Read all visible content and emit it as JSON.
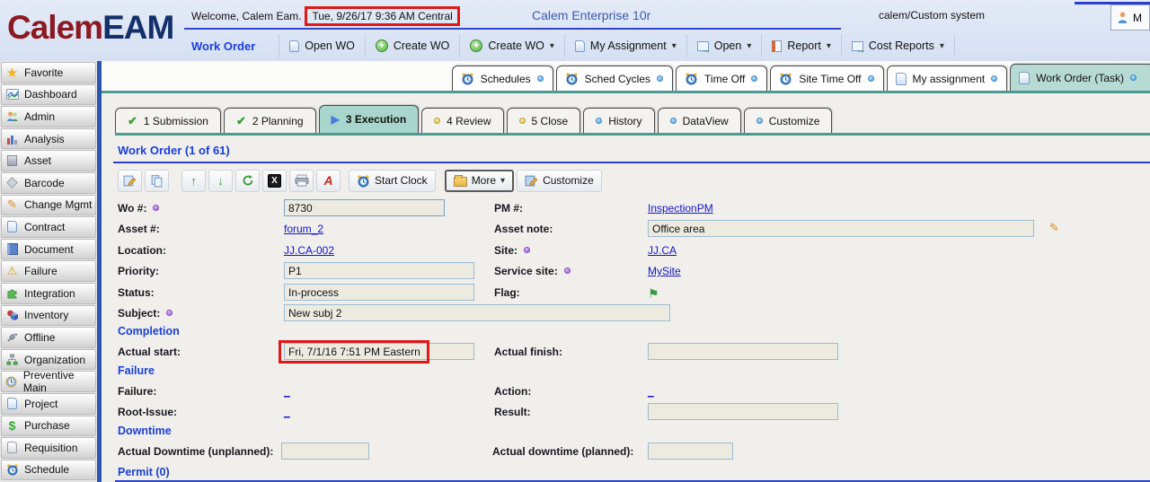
{
  "header": {
    "logo_calem": "Calem",
    "logo_eam": "EAM",
    "welcome": "Welcome, Calem Eam.",
    "datetime": "Tue, 9/26/17 9:36 AM Central",
    "app_title": "Calem Enterprise 10r",
    "user_system": "calem/Custom system",
    "user_button_label": "M"
  },
  "menu": {
    "label": "Work Order",
    "items": [
      {
        "label": "Open WO",
        "icon": "page-icon",
        "dropdown": false
      },
      {
        "label": "Create WO",
        "icon": "plus-icon",
        "dropdown": false
      },
      {
        "label": "Create WO",
        "icon": "plus-icon",
        "dropdown": true
      },
      {
        "label": "My Assignment",
        "icon": "page-icon",
        "dropdown": true
      },
      {
        "label": "Open",
        "icon": "window-arrow-icon",
        "dropdown": true
      },
      {
        "label": "Report",
        "icon": "report-icon",
        "dropdown": true
      },
      {
        "label": "Cost Reports",
        "icon": "window-arrow-icon",
        "dropdown": true
      }
    ]
  },
  "window_tabs": [
    {
      "label": "Schedules",
      "icon": "alarm-clock-icon",
      "active": false
    },
    {
      "label": "Sched Cycles",
      "icon": "alarm-clock-icon",
      "active": false
    },
    {
      "label": "Time Off",
      "icon": "alarm-clock-icon",
      "active": false
    },
    {
      "label": "Site Time Off",
      "icon": "alarm-clock-icon",
      "active": false
    },
    {
      "label": "My assignment",
      "icon": "page-icon",
      "active": false
    },
    {
      "label": "Work Order (Task)",
      "icon": "page-icon",
      "active": true
    }
  ],
  "stage_tabs": [
    {
      "label": "1 Submission",
      "status": "done"
    },
    {
      "label": "2 Planning",
      "status": "done"
    },
    {
      "label": "3 Execution",
      "status": "current"
    },
    {
      "label": "4 Review",
      "status": "pending"
    },
    {
      "label": "5 Close",
      "status": "pending"
    },
    {
      "label": "History",
      "status": "info"
    },
    {
      "label": "DataView",
      "status": "info"
    },
    {
      "label": "Customize",
      "status": "info"
    }
  ],
  "record": {
    "title": "Work Order (1 of 61)",
    "toolbar": {
      "start_clock": "Start Clock",
      "more": "More",
      "customize": "Customize"
    }
  },
  "form": {
    "wo_label": "Wo #:",
    "wo_value": "8730",
    "pm_label": "PM #:",
    "pm_value": "InspectionPM",
    "asset_label": "Asset #:",
    "asset_value": "forum_2",
    "asset_note_label": "Asset note:",
    "asset_note_value": "Office area",
    "location_label": "Location:",
    "location_value": "JJ.CA-002",
    "site_label": "Site:",
    "site_value": "JJ.CA",
    "priority_label": "Priority:",
    "priority_value": "P1",
    "service_site_label": "Service site:",
    "service_site_value": "MySite",
    "status_label": "Status:",
    "status_value": "In-process",
    "flag_label": "Flag:",
    "subject_label": "Subject:",
    "subject_value": "New subj 2",
    "completion_header": "Completion",
    "actual_start_label": "Actual start:",
    "actual_start_value": "Fri, 7/1/16 7:51 PM Eastern",
    "actual_finish_label": "Actual finish:",
    "actual_finish_value": "",
    "failure_header": "Failure",
    "failure_label": "Failure:",
    "failure_value": "_",
    "action_label": "Action:",
    "action_value": "_",
    "root_issue_label": "Root-Issue:",
    "root_issue_value": "_",
    "result_label": "Result:",
    "result_value": "",
    "downtime_header": "Downtime",
    "downtime_unplanned_label": "Actual Downtime (unplanned):",
    "downtime_unplanned_value": "",
    "downtime_planned_label": "Actual downtime (planned):",
    "downtime_planned_value": "",
    "permit_header": "Permit (0)"
  },
  "sidebar": {
    "items": [
      {
        "label": "Favorite"
      },
      {
        "label": "Dashboard"
      },
      {
        "label": "Admin"
      },
      {
        "label": "Analysis"
      },
      {
        "label": "Asset"
      },
      {
        "label": "Barcode"
      },
      {
        "label": "Change Mgmt"
      },
      {
        "label": "Contract"
      },
      {
        "label": "Document"
      },
      {
        "label": "Failure"
      },
      {
        "label": "Integration"
      },
      {
        "label": "Inventory"
      },
      {
        "label": "Offline"
      },
      {
        "label": "Organization"
      },
      {
        "label": "Preventive Main"
      },
      {
        "label": "Project"
      },
      {
        "label": "Purchase"
      },
      {
        "label": "Requisition"
      },
      {
        "label": "Schedule"
      }
    ]
  },
  "icons": {
    "star": "★",
    "pencil": "✎",
    "warning": "⚠",
    "check": "✔",
    "play": "▶",
    "flag": "⚑",
    "arrow_up": "↑",
    "arrow_down": "↓",
    "chevron_down": "▾",
    "dollar": "$",
    "x": "X",
    "pdf": "A",
    "arrow_right": "→",
    "plus": "+"
  },
  "colors": {
    "header_bg": "#d9e2f3",
    "accent_blue": "#2a3fd0",
    "teal_tab": "#b7dbd3",
    "teal_line": "#4b9b92",
    "highlight_red": "#e01818",
    "input_bg": "#edebe0",
    "link": "#1414cc",
    "logo_red": "#8c1822",
    "logo_navy": "#13306a"
  }
}
